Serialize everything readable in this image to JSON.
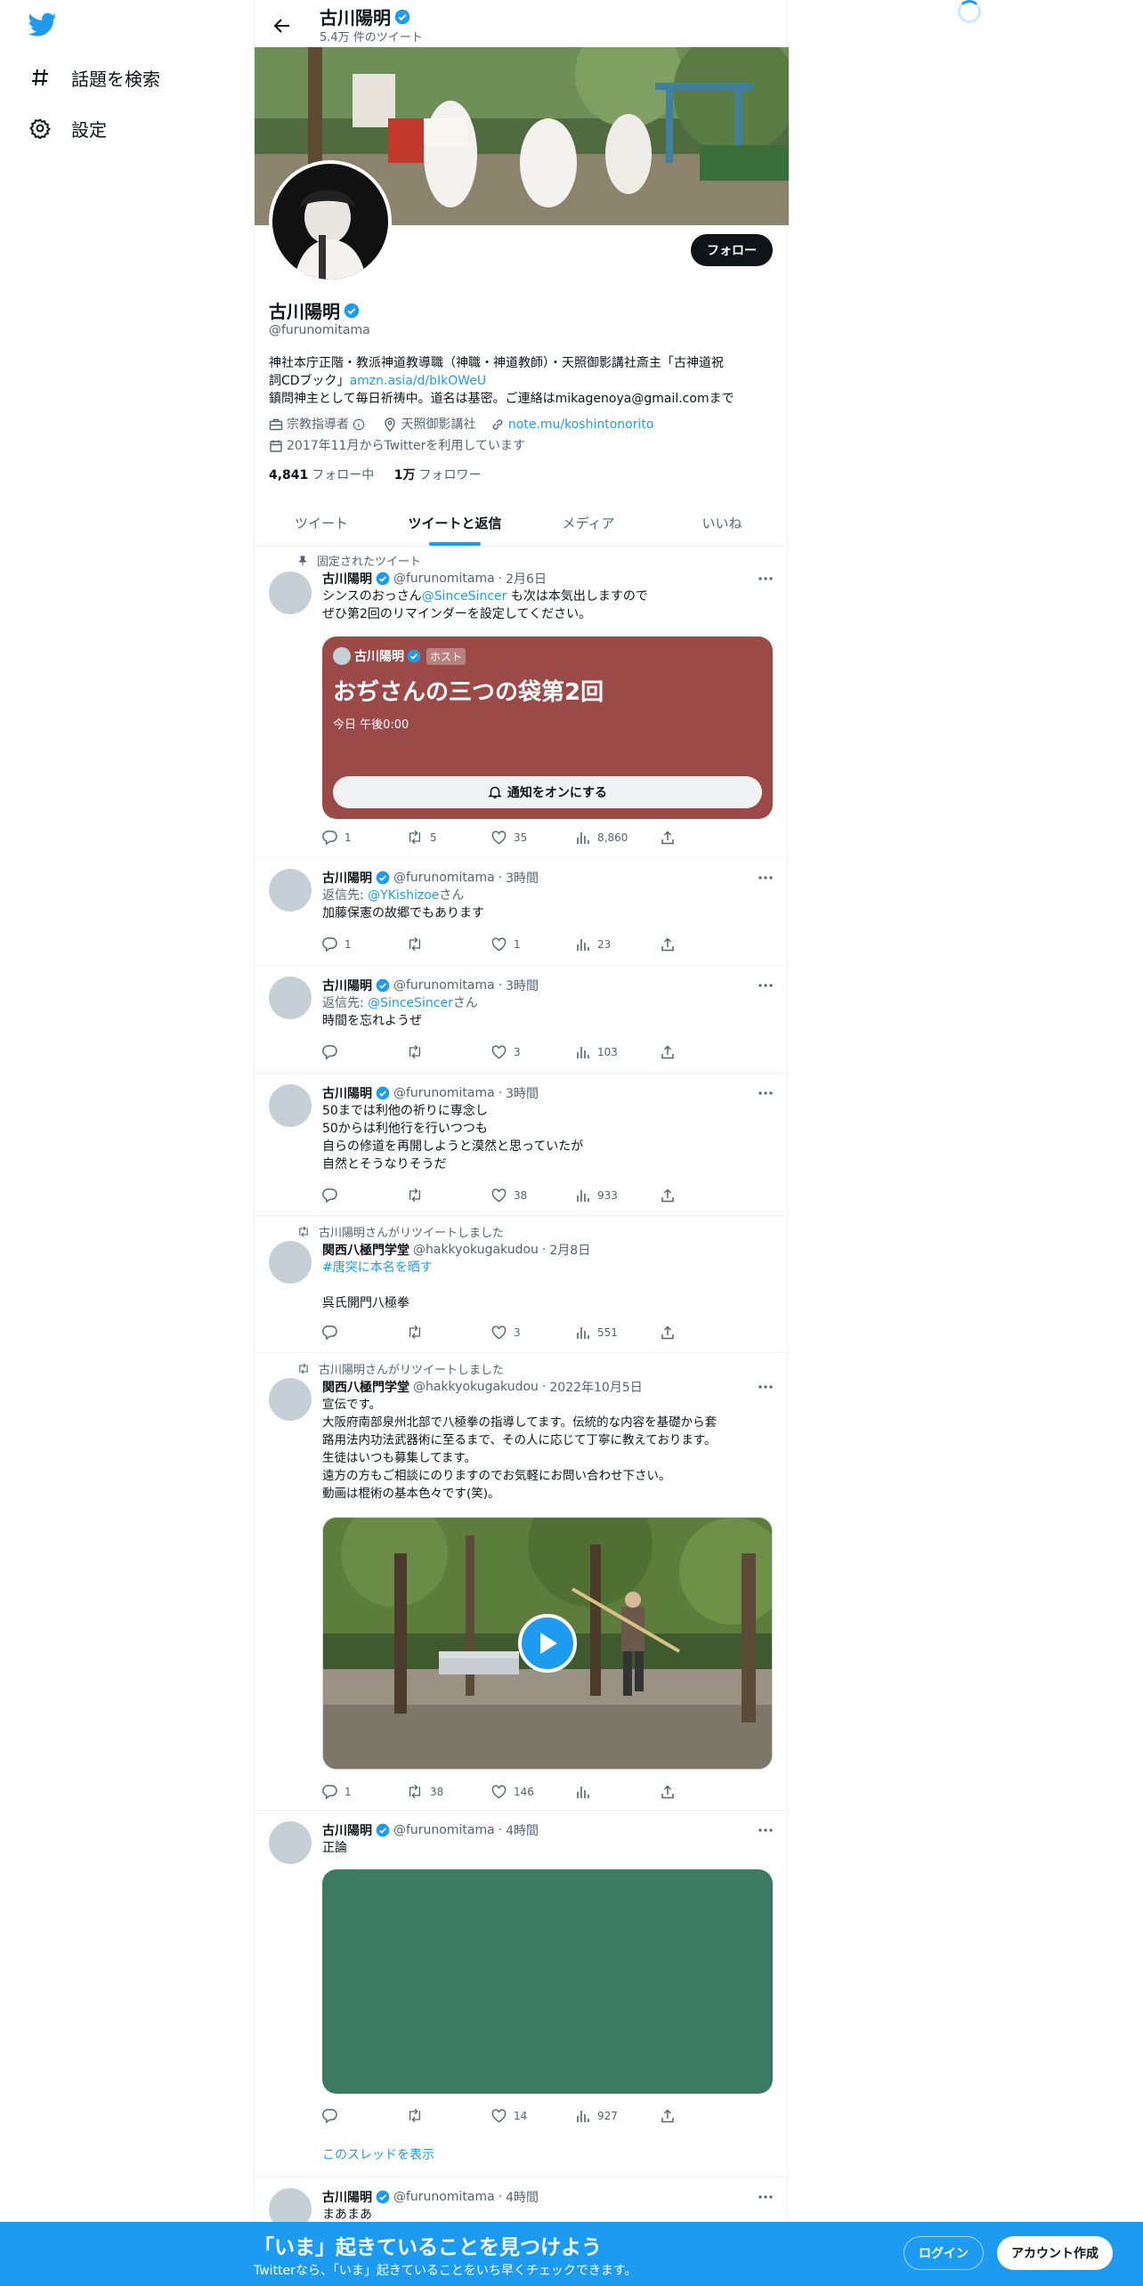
{
  "nav": {
    "explore": "話題を検索",
    "settings": "設定"
  },
  "header": {
    "name": "古川陽明",
    "tweet_count": "5.4万 件のツイート"
  },
  "profile": {
    "name": "古川陽明",
    "handle": "@furunomitama",
    "follow_label": "フォロー",
    "bio_line1": "神社本庁正階・教派神道教導職（神職・神道教師）・天照御影講社斎主「古神道祝",
    "bio_line2_text": "詞CDブック」",
    "bio_link": "amzn.asia/d/bIkOWeU",
    "bio_line3": "鎮問神主として毎日祈祷中。道名は基密。ご連絡はmikagenoya@gmail.comまで",
    "category": "宗教指導者",
    "location": "天照御影講社",
    "website": "note.mu/koshintonorito",
    "joined": "2017年11月からTwitterを利用しています",
    "following_count": "4,841",
    "following_label": "フォロー中",
    "followers_count": "1万",
    "followers_label": "フォロワー"
  },
  "tabs": [
    {
      "label": "ツイート"
    },
    {
      "label": "ツイートと返信"
    },
    {
      "label": "メディア"
    },
    {
      "label": "いいね"
    }
  ],
  "tweets": [
    {
      "pinned_label": "固定されたツイート",
      "name": "古川陽明",
      "handle": "@furunomitama",
      "time": "2月6日",
      "text_pre": "シンスのおっさん",
      "mention": "@SinceSincer",
      "text_post": " も次は本気出しますので",
      "text_line2": "ぜひ第2回のリマインダーを設定してください。",
      "space": {
        "host_name": "古川陽明",
        "host_badge": "ホスト",
        "title": "おぢさんの三つの袋第2回",
        "time": "今日 午後0:00",
        "button": "通知をオンにする"
      },
      "replies": "1",
      "retweets": "5",
      "likes": "35",
      "views": "8,860"
    },
    {
      "name": "古川陽明",
      "handle": "@furunomitama",
      "time": "3時間",
      "reply_prefix": "返信先: ",
      "reply_to": "@YKishizoe",
      "reply_suffix": "さん",
      "text": "加藤保憲の故郷でもあります",
      "replies": "1",
      "retweets": "",
      "likes": "1",
      "views": "23"
    },
    {
      "name": "古川陽明",
      "handle": "@furunomitama",
      "time": "3時間",
      "reply_prefix": "返信先: ",
      "reply_to": "@SinceSincer",
      "reply_suffix": "さん",
      "text": "時間を忘れようぜ",
      "replies": "",
      "retweets": "",
      "likes": "3",
      "views": "103"
    },
    {
      "name": "古川陽明",
      "handle": "@furunomitama",
      "time": "3時間",
      "text": "50までは利他の祈りに専念し\n50からは利他行を行いつつも\n自らの修道を再開しようと漠然と思っていたが\n自然とそうなりそうだ",
      "replies": "",
      "retweets": "",
      "likes": "38",
      "views": "933"
    },
    {
      "retweeted_by": "古川陽明さんがリツイートしました",
      "name": "関西八極門学堂",
      "handle": "@hakkyokugakudou",
      "time": "2月8日",
      "hashtag": "#唐突に本名を晒す",
      "text": "呉氏開門八極拳",
      "replies": "",
      "retweets": "",
      "likes": "3",
      "views": "551"
    },
    {
      "retweeted_by": "古川陽明さんがリツイートしました",
      "name": "関西八極門学堂",
      "handle": "@hakkyokugakudou",
      "time": "2022年10月5日",
      "text": "宣伝です。\n大阪府南部泉州北部で八極拳の指導してます。伝統的な内容を基礎から套\n路用法内功法武器術に至るまで、その人に応じて丁寧に教えております。\n生徒はいつも募集してます。\n遠方の方もご相談にのりますのでお気軽にお問い合わせ下さい。\n動画は棍術の基本色々です(笑)。",
      "replies": "1",
      "retweets": "38",
      "likes": "146",
      "views": ""
    },
    {
      "name": "古川陽明",
      "handle": "@furunomitama",
      "time": "4時間",
      "text": "正論",
      "media_color": "#3d7a64",
      "replies": "",
      "retweets": "",
      "likes": "14",
      "views": "927",
      "thread_link": "このスレッドを表示"
    },
    {
      "name": "古川陽明",
      "handle": "@furunomitama",
      "time": "4時間",
      "text": "まあまあ"
    }
  ],
  "bottom_bar": {
    "title": "「いま」起きていることを見つけよう",
    "subtitle": "Twitterなら、「いま」起きていることをいち早くチェックできます。",
    "login": "ログイン",
    "signup": "アカウント作成"
  },
  "colors": {
    "accent": "#1d9bf0",
    "space_card": "#9c4a48",
    "dark": "#0f1419"
  }
}
